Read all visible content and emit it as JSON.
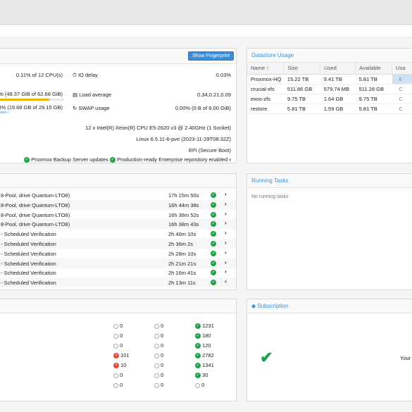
{
  "status": {
    "show_fingerprint_label": "Show Fingerprint",
    "cpu_value": "0.11% of 12 CPU(s)",
    "io_delay_label": "IO delay",
    "io_delay_value": "0.03%",
    "mem_value": "% (48.37 GiB of 62.68 GiB)",
    "mem_fraction": 0.77,
    "load_label": "Load average",
    "load_value": "0.34,0.21,0.09",
    "root_value": "3% (19.68 GB of 29.15 GB)",
    "root_fraction": 0.68,
    "swap_label": "SWAP usage",
    "swap_value": "0.00% (0 B of 8.00 GiB)",
    "cpu_model": "12 x Intel(R) Xeon(R) CPU E5-2620 v3 @ 2.40GHz (1 Socket)",
    "kernel": "Linux 6.5.11-6-pve (2023-11-29T08:32Z)",
    "boot_mode": "EFI (Secure Boot)",
    "updates_label": "Proxmox Backup Server updates",
    "repo_label": "Production-ready Enterprise repository enabled"
  },
  "datastore": {
    "title": "Datastore Usage",
    "columns": [
      "Name ↑",
      "Size",
      "Used",
      "Available",
      "Usa"
    ],
    "rows": [
      {
        "name": "Proxmox-HQ",
        "size": "15.22 TB",
        "used": "9.41 TB",
        "avail": "5.81 TB",
        "usage": "6"
      },
      {
        "name": "crucial-xfs",
        "size": "511.86 GB",
        "used": "579.74 MB",
        "avail": "511.28 GB",
        "usage": "C"
      },
      {
        "name": "exos-zfs",
        "size": "9.75 TB",
        "used": "1.64 GB",
        "avail": "9.75 TB",
        "usage": "C"
      },
      {
        "name": "restore",
        "size": "5.81 TB",
        "used": "1.59 GB",
        "avail": "5.81 TB",
        "usage": "C"
      }
    ]
  },
  "tasks": [
    {
      "desc": "8-Pool, drive Quantum-LTO8)",
      "duration": "17h 15m 50s"
    },
    {
      "desc": "8-Pool, drive Quantum-LTO8)",
      "duration": "16h 44m 38s"
    },
    {
      "desc": "8-Pool, drive Quantum-LTO8)",
      "duration": "16h 38m 52s"
    },
    {
      "desc": "8-Pool, drive Quantum-LTO8)",
      "duration": "16h 38m 43s"
    },
    {
      "desc": "- Scheduled Verification",
      "duration": "2h 40m 10s"
    },
    {
      "desc": "- Scheduled Verification",
      "duration": "2h 36m 2s"
    },
    {
      "desc": "- Scheduled Verification",
      "duration": "2h 28m 10s"
    },
    {
      "desc": "- Scheduled Verification",
      "duration": "2h 21m 21s"
    },
    {
      "desc": "- Scheduled Verification",
      "duration": "2h 16m 41s"
    },
    {
      "desc": "- Scheduled Verification",
      "duration": "2h 13m 11s"
    }
  ],
  "running": {
    "title": "Running Tasks",
    "empty": "No running tasks"
  },
  "summary_rows": [
    {
      "a": "0",
      "a_state": "grey",
      "b": "0",
      "c": "1231"
    },
    {
      "a": "0",
      "a_state": "grey",
      "b": "0",
      "c": "180"
    },
    {
      "a": "0",
      "a_state": "grey",
      "b": "0",
      "c": "120"
    },
    {
      "a": "101",
      "a_state": "err",
      "b": "0",
      "c": "2782"
    },
    {
      "a": "10",
      "a_state": "err",
      "b": "0",
      "c": "1341"
    },
    {
      "a": "0",
      "a_state": "grey",
      "b": "0",
      "c": "30"
    },
    {
      "a": "0",
      "a_state": "grey",
      "b": "0",
      "c": "0",
      "c_state": "grey"
    }
  ],
  "subscription": {
    "title": "Subscription",
    "text": "Your"
  },
  "colors": {
    "accent": "#3b8fd4",
    "ok": "#21a04a",
    "error": "#e2493b",
    "bar": "#f0b400"
  }
}
